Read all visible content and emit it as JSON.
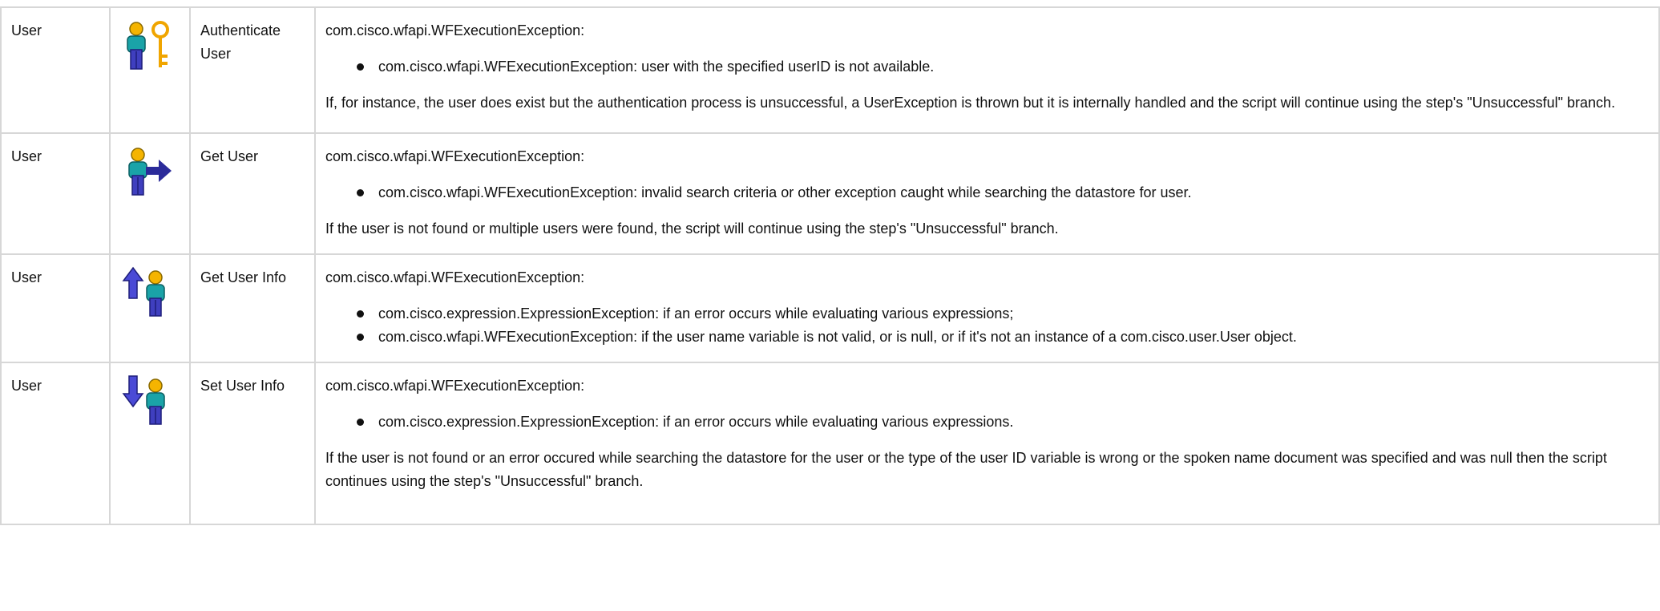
{
  "rows": [
    {
      "category": "User",
      "icon": "authenticate-user-icon",
      "step": "Authenticate User",
      "exception_title": "com.cisco.wfapi.WFExecutionException:",
      "items": [
        "com.cisco.wfapi.WFExecutionException: user with the specified userID is not available."
      ],
      "note": "If, for instance, the user does exist but the authentication process is unsuccessful, a UserException is thrown but it is internally handled and the script will continue using the step's \"Unsuccessful\" branch."
    },
    {
      "category": "User",
      "icon": "get-user-icon",
      "step": "Get User",
      "exception_title": "com.cisco.wfapi.WFExecutionException:",
      "items": [
        "com.cisco.wfapi.WFExecutionException: invalid search criteria or other exception caught while searching the datastore for user."
      ],
      "note": "If the user is not found or multiple users were found, the script will continue using the step's \"Unsuccessful\" branch."
    },
    {
      "category": "User",
      "icon": "get-user-info-icon",
      "step": "Get User Info",
      "exception_title": "com.cisco.wfapi.WFExecutionException:",
      "items": [
        "com.cisco.expression.ExpressionException: if an error occurs while evaluating various expressions;",
        "com.cisco.wfapi.WFExecutionException: if the user name variable is not valid, or is null, or if it's not an instance of a com.cisco.user.User object."
      ],
      "note": ""
    },
    {
      "category": "User",
      "icon": "set-user-info-icon",
      "step": "Set User Info",
      "exception_title": "com.cisco.wfapi.WFExecutionException:",
      "items": [
        "com.cisco.expression.ExpressionException: if an error occurs while evaluating various expressions."
      ],
      "note": "If the user is not found or an error occured while searching the datastore for the user or the type of the user ID variable is wrong or the spoken name document was specified and was null then the script continues using the step's \"Unsuccessful\" branch."
    }
  ],
  "colors": {
    "border": "#d7d7d7",
    "person_head": "#f5b400",
    "person_body": "#1aa3a8",
    "person_legs": "#3f3fbf",
    "arrow": "#2b2b9a",
    "key": "#f0a500"
  }
}
